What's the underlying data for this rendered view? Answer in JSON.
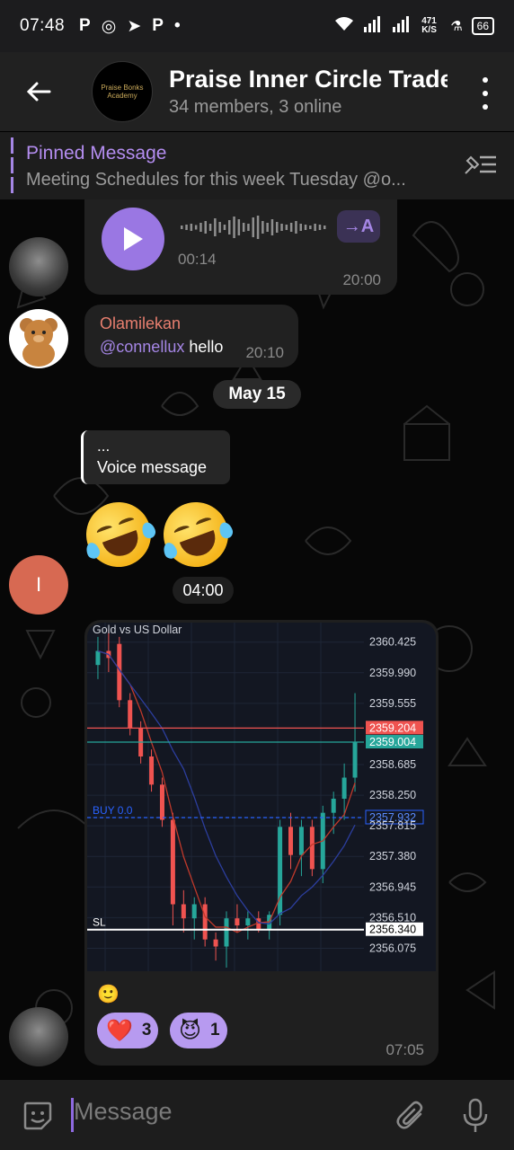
{
  "status_bar": {
    "time": "07:48",
    "apps": [
      "P",
      "◎",
      "➤",
      "P",
      "•"
    ],
    "net_speed": "471 K/S",
    "battery": "66"
  },
  "header": {
    "title": "Praise Inner Circle Trade",
    "subtitle": "34 members, 3 online"
  },
  "pinned": {
    "label": "Pinned Message",
    "text": "Meeting Schedules for this week   Tuesday @o..."
  },
  "messages": {
    "voice": {
      "duration": "00:14",
      "time": "20:00",
      "transcribe": "→A"
    },
    "text_msg": {
      "sender": "Olamilekan",
      "mention": "@connellux",
      "text": " hello",
      "time": "20:10"
    },
    "date_divider": "May 15",
    "reply": {
      "line1": "...",
      "line2": "Voice message"
    },
    "emoji_time": "04:00",
    "avatar_letter": "I",
    "chart_msg": {
      "caption_emoji": "🙂",
      "time": "07:05",
      "reactions": [
        {
          "emoji": "❤️",
          "count": "3"
        },
        {
          "emoji": "😈",
          "count": "1"
        }
      ]
    }
  },
  "composer": {
    "placeholder": "Message"
  },
  "colors": {
    "accent": "#a586e5",
    "sender": "#e97f6f",
    "bull": "#26a69a",
    "bear": "#ef5350"
  },
  "chart_data": {
    "type": "candlestick",
    "title": "Gold vs US Dollar",
    "y_ticks": [
      "2360.425",
      "2359.990",
      "2359.555",
      "2359.204",
      "2359.004",
      "2358.685",
      "2358.250",
      "2357.932",
      "2357.815",
      "2357.380",
      "2356.945",
      "2356.510",
      "2356.340",
      "2356.075"
    ],
    "ylim": [
      2355.8,
      2360.6
    ],
    "lines": [
      {
        "label": "",
        "value": 2359.204,
        "color": "#ef5350"
      },
      {
        "label": "",
        "value": 2359.004,
        "color": "#26a69a"
      },
      {
        "label": "BUY 0.0",
        "value": 2357.932,
        "color": "#2962ff"
      },
      {
        "label": "SL",
        "value": 2356.34,
        "color": "#ffffff"
      }
    ],
    "candles": [
      {
        "o": 2360.1,
        "h": 2360.5,
        "l": 2359.9,
        "c": 2360.3
      },
      {
        "o": 2360.3,
        "h": 2360.6,
        "l": 2360.0,
        "c": 2360.2
      },
      {
        "o": 2360.4,
        "h": 2360.5,
        "l": 2359.5,
        "c": 2359.6
      },
      {
        "o": 2359.6,
        "h": 2359.7,
        "l": 2359.1,
        "c": 2359.2
      },
      {
        "o": 2359.2,
        "h": 2359.3,
        "l": 2358.7,
        "c": 2358.8
      },
      {
        "o": 2358.8,
        "h": 2358.9,
        "l": 2358.3,
        "c": 2358.4
      },
      {
        "o": 2358.4,
        "h": 2358.5,
        "l": 2357.8,
        "c": 2357.9
      },
      {
        "o": 2357.9,
        "h": 2358.0,
        "l": 2356.4,
        "c": 2356.7
      },
      {
        "o": 2356.7,
        "h": 2356.9,
        "l": 2356.3,
        "c": 2356.5
      },
      {
        "o": 2356.5,
        "h": 2356.8,
        "l": 2356.2,
        "c": 2356.7
      },
      {
        "o": 2356.7,
        "h": 2356.8,
        "l": 2356.1,
        "c": 2356.2
      },
      {
        "o": 2356.2,
        "h": 2356.3,
        "l": 2355.9,
        "c": 2356.1
      },
      {
        "o": 2356.1,
        "h": 2356.6,
        "l": 2355.8,
        "c": 2356.5
      },
      {
        "o": 2356.5,
        "h": 2356.7,
        "l": 2356.3,
        "c": 2356.4
      },
      {
        "o": 2356.4,
        "h": 2356.6,
        "l": 2356.2,
        "c": 2356.5
      },
      {
        "o": 2356.5,
        "h": 2356.6,
        "l": 2356.3,
        "c": 2356.35
      },
      {
        "o": 2356.35,
        "h": 2356.6,
        "l": 2356.2,
        "c": 2356.55
      },
      {
        "o": 2356.55,
        "h": 2357.9,
        "l": 2356.4,
        "c": 2357.8
      },
      {
        "o": 2357.8,
        "h": 2358.0,
        "l": 2357.2,
        "c": 2357.4
      },
      {
        "o": 2357.4,
        "h": 2357.9,
        "l": 2357.1,
        "c": 2357.8
      },
      {
        "o": 2357.8,
        "h": 2357.9,
        "l": 2357.1,
        "c": 2357.2
      },
      {
        "o": 2357.2,
        "h": 2358.1,
        "l": 2357.0,
        "c": 2358.0
      },
      {
        "o": 2358.0,
        "h": 2358.3,
        "l": 2357.7,
        "c": 2358.2
      },
      {
        "o": 2358.2,
        "h": 2358.7,
        "l": 2357.9,
        "c": 2358.5
      },
      {
        "o": 2358.5,
        "h": 2359.7,
        "l": 2358.3,
        "c": 2359.0
      }
    ]
  }
}
